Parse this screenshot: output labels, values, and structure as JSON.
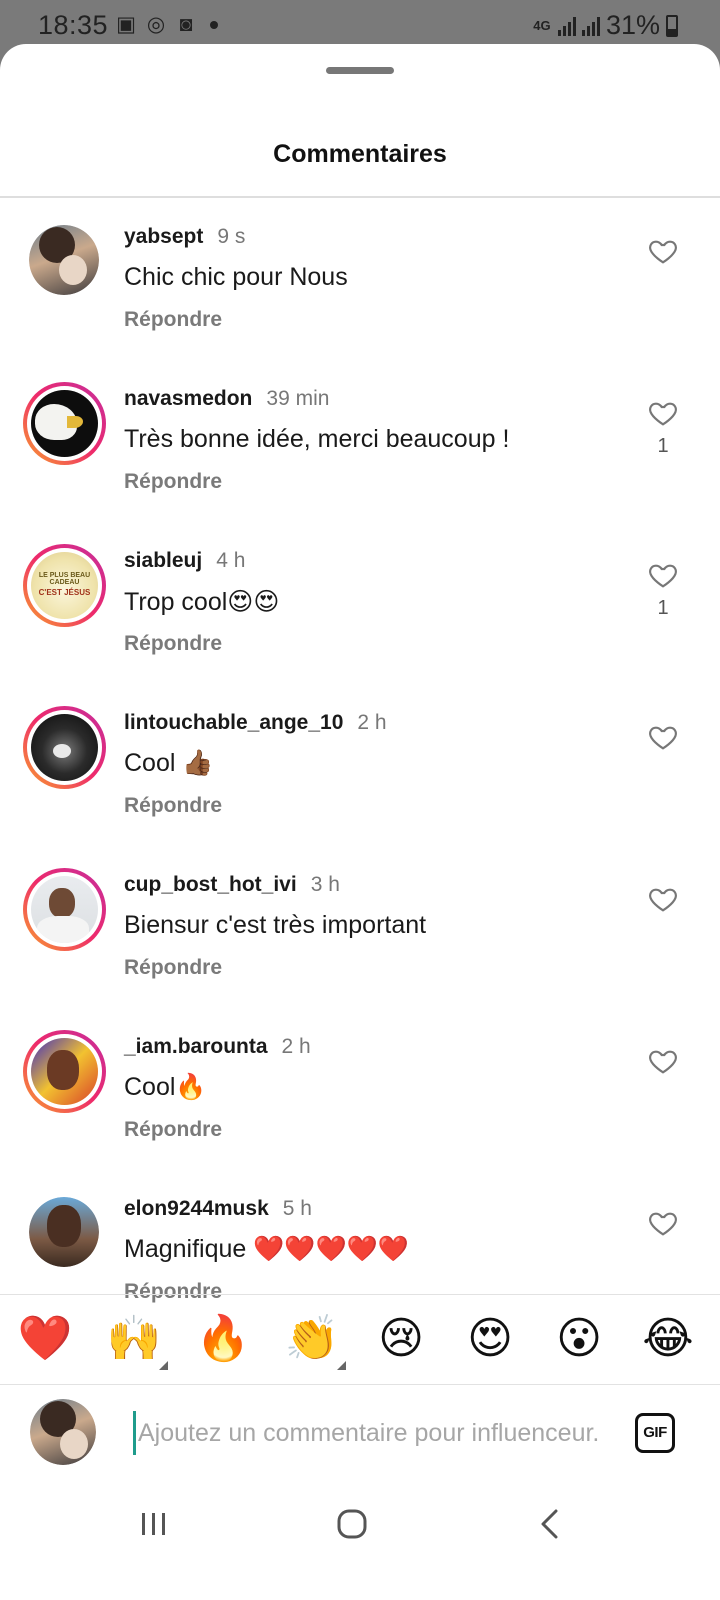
{
  "status_bar": {
    "time": "18:35",
    "network": "4G",
    "battery": "31%"
  },
  "sheet": {
    "title": "Commentaires"
  },
  "comments": [
    {
      "username": "yabsept",
      "time": "9 s",
      "text": "Chic chic pour Nous",
      "reply": "Répondre",
      "likes": ""
    },
    {
      "username": "navasmedon",
      "time": "39 min",
      "text": "Très bonne idée, merci beaucoup !",
      "reply": "Répondre",
      "likes": "1"
    },
    {
      "username": "siableuj",
      "time": "4 h",
      "text": "Trop cool😍😍",
      "reply": "Répondre",
      "likes": "1"
    },
    {
      "username": "lintouchable_ange_10",
      "time": "2 h",
      "text": "Cool 👍🏾",
      "reply": "Répondre",
      "likes": ""
    },
    {
      "username": "cup_bost_hot_ivi",
      "time": "3 h",
      "text": "Biensur c'est très important",
      "reply": "Répondre",
      "likes": ""
    },
    {
      "username": "_iam.barounta",
      "time": "2 h",
      "text": "Cool🔥",
      "reply": "Répondre",
      "likes": ""
    },
    {
      "username": "elon9244musk",
      "time": "5 h",
      "text": "Magnifique ❤️❤️❤️❤️❤️",
      "reply": "Répondre",
      "likes": ""
    }
  ],
  "siableuj_avatar_text": [
    "LE PLUS BEAU CADEAU",
    "C'EST JÉSUS"
  ],
  "emoji_bar": [
    "❤️",
    "🙌",
    "🔥",
    "👏",
    "😢",
    "😍",
    "😮",
    "😂"
  ],
  "composer": {
    "placeholder": "Ajoutez un commentaire pour influenceur.",
    "gif_label": "GIF"
  },
  "colors": {
    "story_ring_start": "#f9a22d",
    "story_ring_end": "#c42e9f",
    "cursor": "#1f9c8c",
    "secondary_text": "#777777"
  }
}
